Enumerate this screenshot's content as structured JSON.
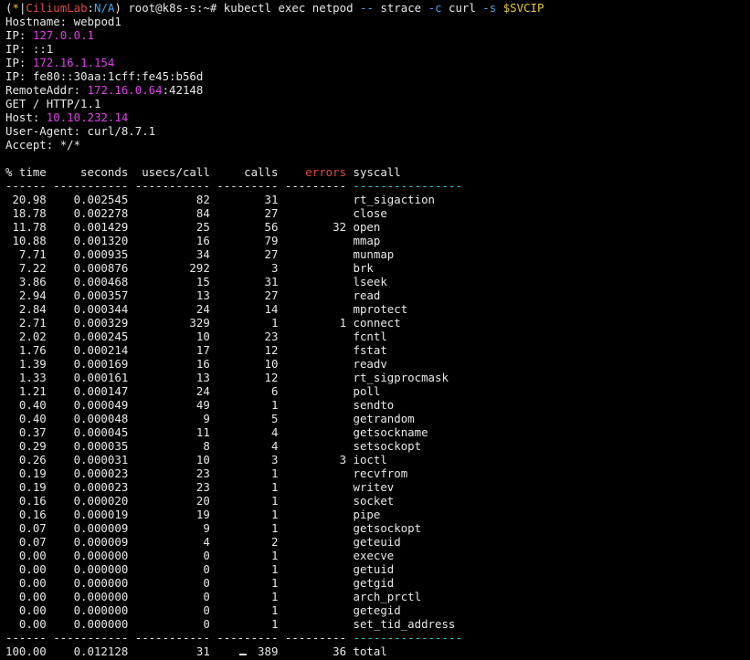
{
  "colors": {
    "background": "#000000",
    "text": "#e8e8e8",
    "magenta": "#e040e8",
    "yellow": "#e8c83a",
    "blue": "#4aa6e8",
    "red": "#e04848",
    "cyan": "#2cc2d8"
  },
  "prompt": {
    "open": "(",
    "star": "*",
    "bar": "|",
    "context": "CiliumLab",
    "colon": ":",
    "namespace": "N/A",
    "close": ")",
    "userhost": "root@k8s-s:~#",
    "cmd1": "kubectl exec netpod ",
    "dashdash": "--",
    "cmd2": " strace ",
    "flag_c": "-c",
    "cmd3": " curl ",
    "flag_s": "-s",
    "svcip": "$SVCIP"
  },
  "output": [
    {
      "label": "Hostname:",
      "value": "webpod1",
      "style": "plain"
    },
    {
      "label": "IP:",
      "value": "127.0.0.1",
      "style": "magenta"
    },
    {
      "label": "IP:",
      "value": "::1",
      "style": "plain"
    },
    {
      "label": "IP:",
      "value": "172.16.1.154",
      "style": "magenta"
    },
    {
      "label": "IP:",
      "value": "fe80::30aa:1cff:fe45:b56d",
      "style": "plain"
    },
    {
      "label": "RemoteAddr:",
      "value": "172.16.0.64",
      "suffix": ":42148",
      "style": "magenta"
    },
    {
      "label": "",
      "value": "GET / HTTP/1.1",
      "style": "plain"
    },
    {
      "label": "Host:",
      "value": "10.10.232.14",
      "style": "magenta"
    },
    {
      "label": "User-Agent:",
      "value": "curl/8.7.1",
      "style": "plain"
    },
    {
      "label": "Accept:",
      "value": "*/*",
      "style": "plain"
    }
  ],
  "strace": {
    "headers": [
      "% time",
      "seconds",
      "usecs/call",
      "calls",
      "errors",
      "syscall"
    ],
    "separators": [
      "------",
      "-----------",
      "-----------",
      "---------",
      "---------",
      "----------------"
    ],
    "rows": [
      [
        "20.98",
        "0.002545",
        "82",
        "31",
        "",
        "rt_sigaction"
      ],
      [
        "18.78",
        "0.002278",
        "84",
        "27",
        "",
        "close"
      ],
      [
        "11.78",
        "0.001429",
        "25",
        "56",
        "32",
        "open"
      ],
      [
        "10.88",
        "0.001320",
        "16",
        "79",
        "",
        "mmap"
      ],
      [
        "7.71",
        "0.000935",
        "34",
        "27",
        "",
        "munmap"
      ],
      [
        "7.22",
        "0.000876",
        "292",
        "3",
        "",
        "brk"
      ],
      [
        "3.86",
        "0.000468",
        "15",
        "31",
        "",
        "lseek"
      ],
      [
        "2.94",
        "0.000357",
        "13",
        "27",
        "",
        "read"
      ],
      [
        "2.84",
        "0.000344",
        "24",
        "14",
        "",
        "mprotect"
      ],
      [
        "2.71",
        "0.000329",
        "329",
        "1",
        "1",
        "connect"
      ],
      [
        "2.02",
        "0.000245",
        "10",
        "23",
        "",
        "fcntl"
      ],
      [
        "1.76",
        "0.000214",
        "17",
        "12",
        "",
        "fstat"
      ],
      [
        "1.39",
        "0.000169",
        "16",
        "10",
        "",
        "readv"
      ],
      [
        "1.33",
        "0.000161",
        "13",
        "12",
        "",
        "rt_sigprocmask"
      ],
      [
        "1.21",
        "0.000147",
        "24",
        "6",
        "",
        "poll"
      ],
      [
        "0.40",
        "0.000049",
        "49",
        "1",
        "",
        "sendto"
      ],
      [
        "0.40",
        "0.000048",
        "9",
        "5",
        "",
        "getrandom"
      ],
      [
        "0.37",
        "0.000045",
        "11",
        "4",
        "",
        "getsockname"
      ],
      [
        "0.29",
        "0.000035",
        "8",
        "4",
        "",
        "setsockopt"
      ],
      [
        "0.26",
        "0.000031",
        "10",
        "3",
        "3",
        "ioctl"
      ],
      [
        "0.19",
        "0.000023",
        "23",
        "1",
        "",
        "recvfrom"
      ],
      [
        "0.19",
        "0.000023",
        "23",
        "1",
        "",
        "writev"
      ],
      [
        "0.16",
        "0.000020",
        "20",
        "1",
        "",
        "socket"
      ],
      [
        "0.16",
        "0.000019",
        "19",
        "1",
        "",
        "pipe"
      ],
      [
        "0.07",
        "0.000009",
        "9",
        "1",
        "",
        "getsockopt"
      ],
      [
        "0.07",
        "0.000009",
        "4",
        "2",
        "",
        "geteuid"
      ],
      [
        "0.00",
        "0.000000",
        "0",
        "1",
        "",
        "execve"
      ],
      [
        "0.00",
        "0.000000",
        "0",
        "1",
        "",
        "getuid"
      ],
      [
        "0.00",
        "0.000000",
        "0",
        "1",
        "",
        "getgid"
      ],
      [
        "0.00",
        "0.000000",
        "0",
        "1",
        "",
        "arch_prctl"
      ],
      [
        "0.00",
        "0.000000",
        "0",
        "1",
        "",
        "getegid"
      ],
      [
        "0.00",
        "0.000000",
        "0",
        "1",
        "",
        "set_tid_address"
      ]
    ],
    "total": [
      "100.00",
      "0.012128",
      "31",
      "389",
      "36",
      "total"
    ]
  }
}
